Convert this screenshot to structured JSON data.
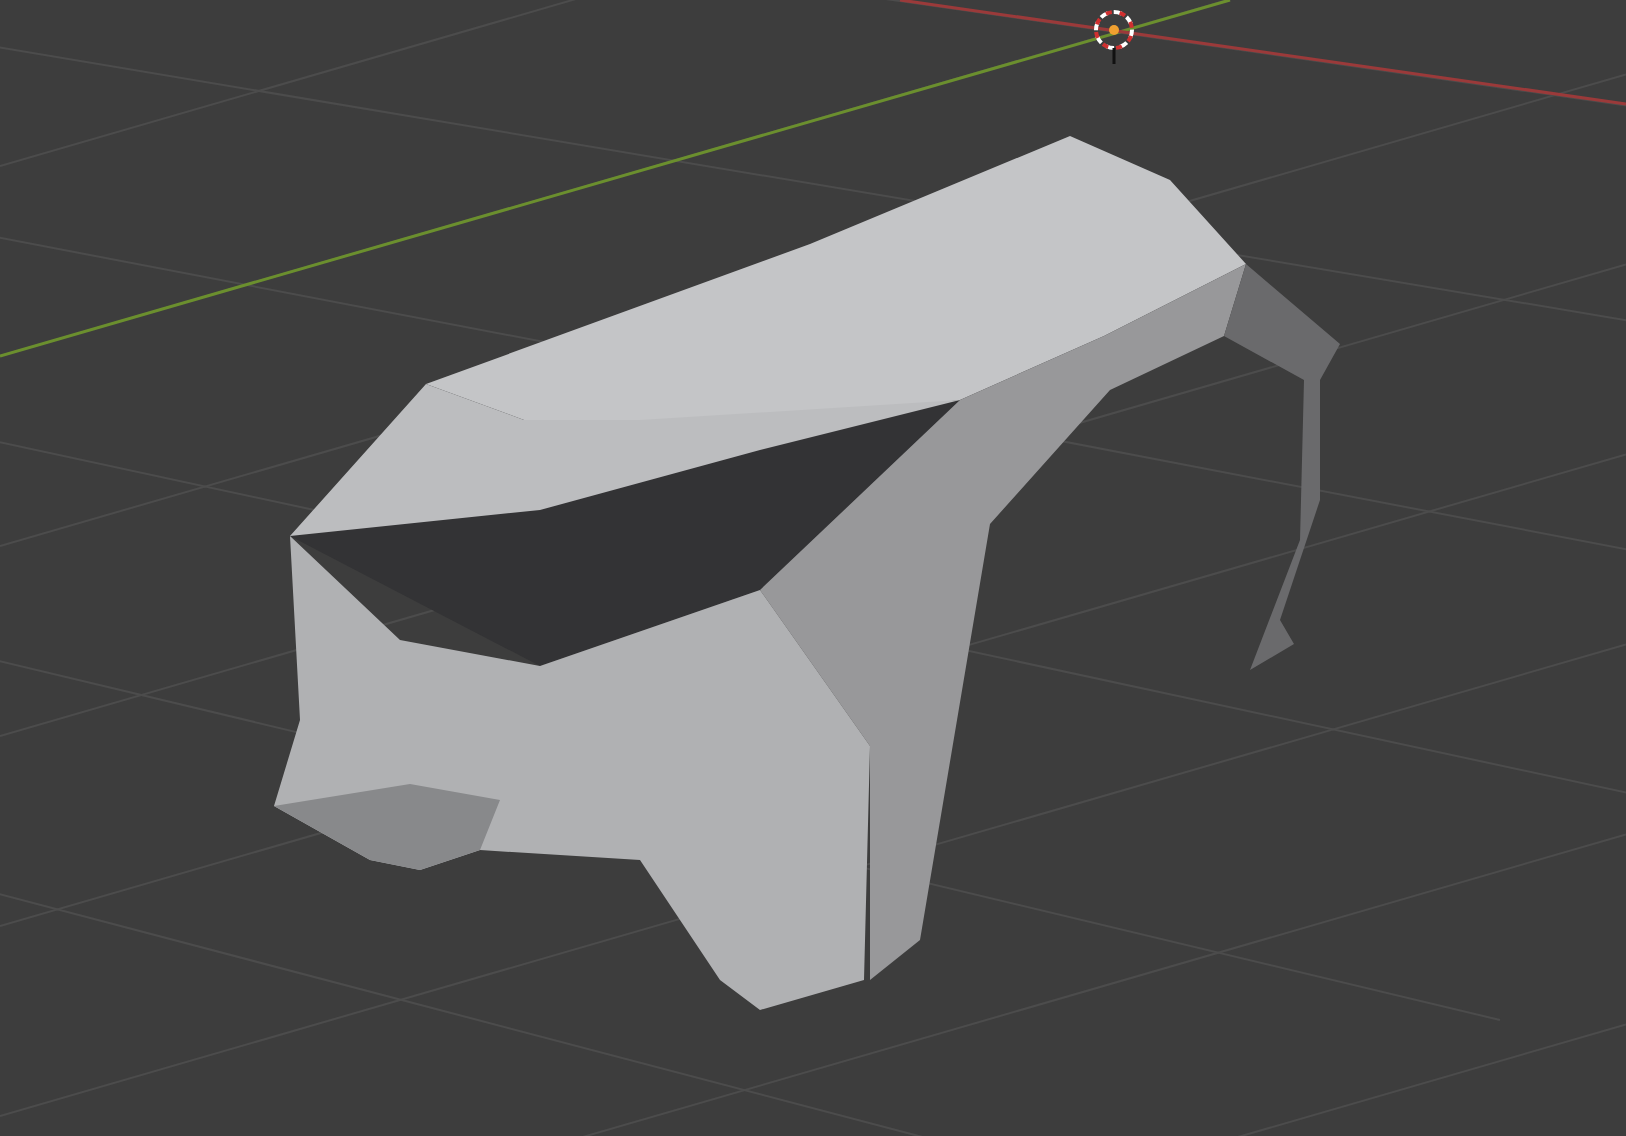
{
  "viewport": {
    "kind": "perspective"
  }
}
